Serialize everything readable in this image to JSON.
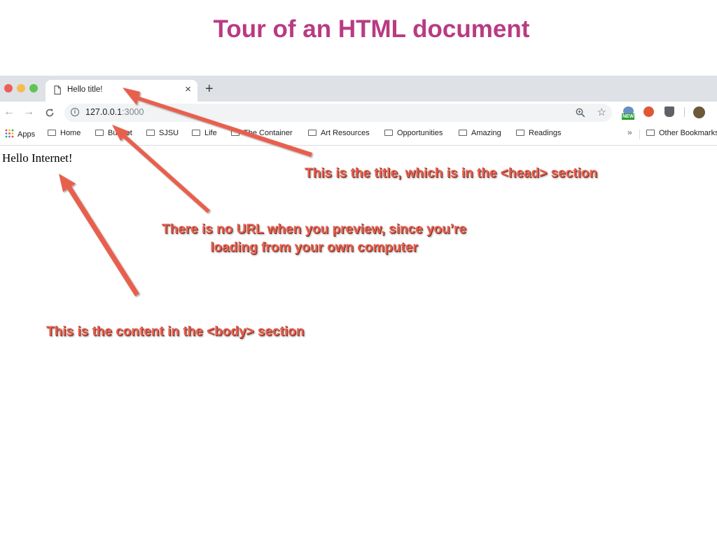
{
  "slide": {
    "title": "Tour of an HTML document"
  },
  "browser": {
    "tab": {
      "title": "Hello title!",
      "close_glyph": "×"
    },
    "new_tab_glyph": "+",
    "nav": {
      "back_glyph": "←",
      "forward_glyph": "→",
      "reload_glyph": "C"
    },
    "address": {
      "host": "127.0.0.1",
      "port": ":3000"
    },
    "extensions": {
      "new_badge": "NEW"
    },
    "bookmarks": {
      "apps": "Apps",
      "items": [
        "Home",
        "Budget",
        "SJSU",
        "Life",
        "The Container",
        "Art Resources",
        "Opportunities",
        "Amazing",
        "Readings"
      ],
      "overflow": "»",
      "other": "Other Bookmarks"
    }
  },
  "page": {
    "body_text": "Hello Internet!"
  },
  "annotations": {
    "title_note": "This is the title, which is in the <head> section",
    "url_note_line1": "There is no URL when you preview, since you’re",
    "url_note_line2": "loading from your own computer",
    "body_note": "This is the content in the <body> section"
  },
  "colors": {
    "slide_title": "#b83b83",
    "annotation": "#e8604e",
    "tabstrip": "#dee1e6"
  },
  "icons": [
    "page-icon",
    "close-icon",
    "plus-icon",
    "back-arrow-icon",
    "forward-arrow-icon",
    "reload-icon",
    "info-icon",
    "zoom-icon",
    "star-icon",
    "apps-grid-icon",
    "folder-icon",
    "duckduckgo-icon",
    "shield-icon",
    "avatar",
    "arrow-icon"
  ]
}
